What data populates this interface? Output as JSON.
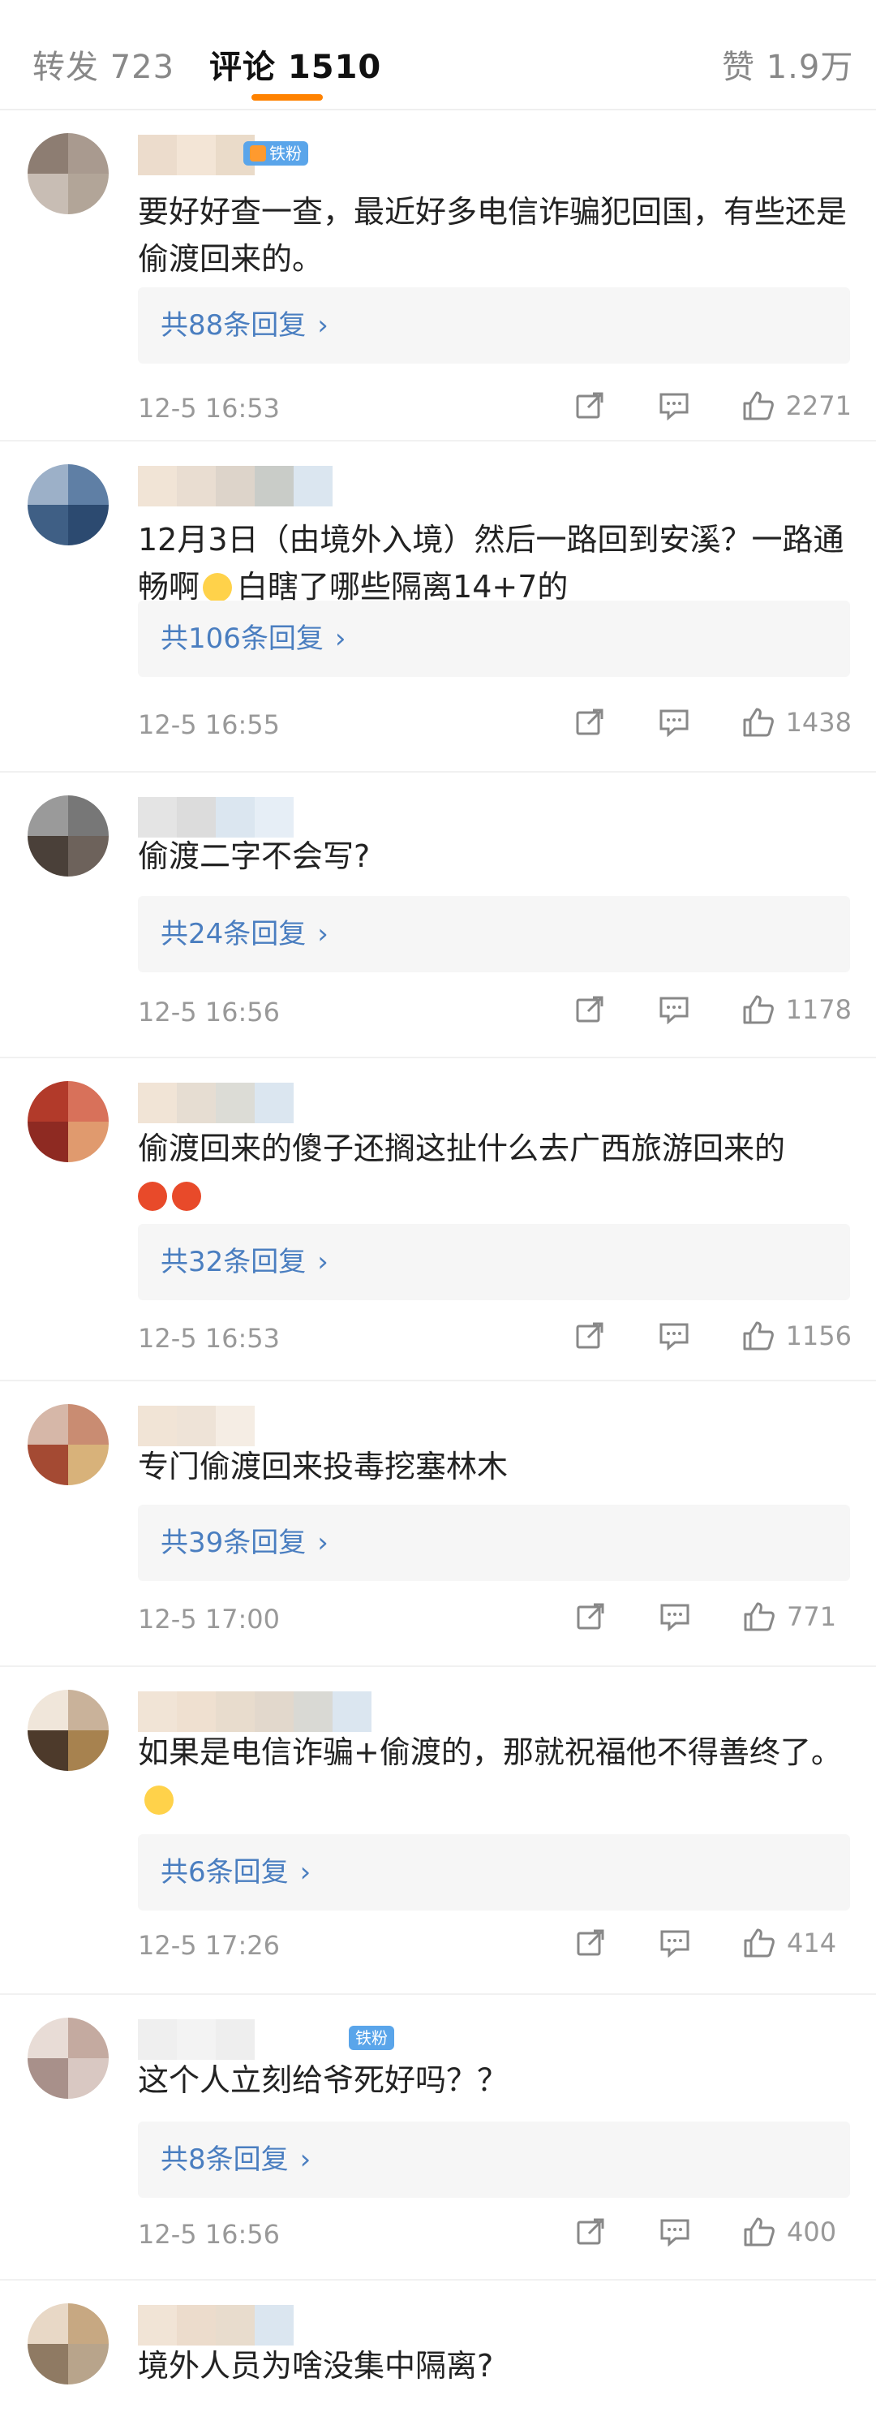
{
  "tabs": [
    {
      "label": "转发 723"
    },
    {
      "label": "评论 1510"
    },
    {
      "label": "赞 1.9万"
    }
  ],
  "colors": {
    "accent": "#ff8200",
    "link": "#4a7ec0",
    "badge": "#5aa5ea"
  },
  "comments": [
    {
      "text": "要好好查一查，最近好多电信诈骗犯回国，有些还是偷渡回来的。",
      "replies": "共88条回复",
      "time": "12-5 16:53",
      "likes": "2271",
      "badge": "铁粉"
    },
    {
      "text": "12月3日（由境外入境）然后一路回到安溪？一路通畅啊",
      "text2": "白瞎了哪些隔离14+7的",
      "replies": "共106条回复",
      "time": "12-5 16:55",
      "likes": "1438"
    },
    {
      "text": "偷渡二字不会写?",
      "replies": "共24条回复",
      "time": "12-5 16:56",
      "likes": "1178"
    },
    {
      "text": "偷渡回来的傻子还搁这扯什么去广西旅游回来的",
      "replies": "共32条回复",
      "time": "12-5 16:53",
      "likes": "1156"
    },
    {
      "text": "专门偷渡回来投毒挖塞林木",
      "replies": "共39条回复",
      "time": "12-5 17:00",
      "likes": "771"
    },
    {
      "text": "如果是电信诈骗+偷渡的，那就祝福他不得善终了。",
      "replies": "共6条回复",
      "time": "12-5 17:26",
      "likes": "414"
    },
    {
      "text": "这个人立刻给爷死好吗？？",
      "replies": "共8条回复",
      "time": "12-5 16:56",
      "likes": "400",
      "badge": "铁粉"
    },
    {
      "text": "境外人员为啥没集中隔离?"
    }
  ],
  "icons": {
    "share": "share-icon",
    "comment": "comment-icon",
    "like": "thumbs-up-icon",
    "chevron": "chevron-right-icon"
  },
  "chevron_glyph": "›"
}
